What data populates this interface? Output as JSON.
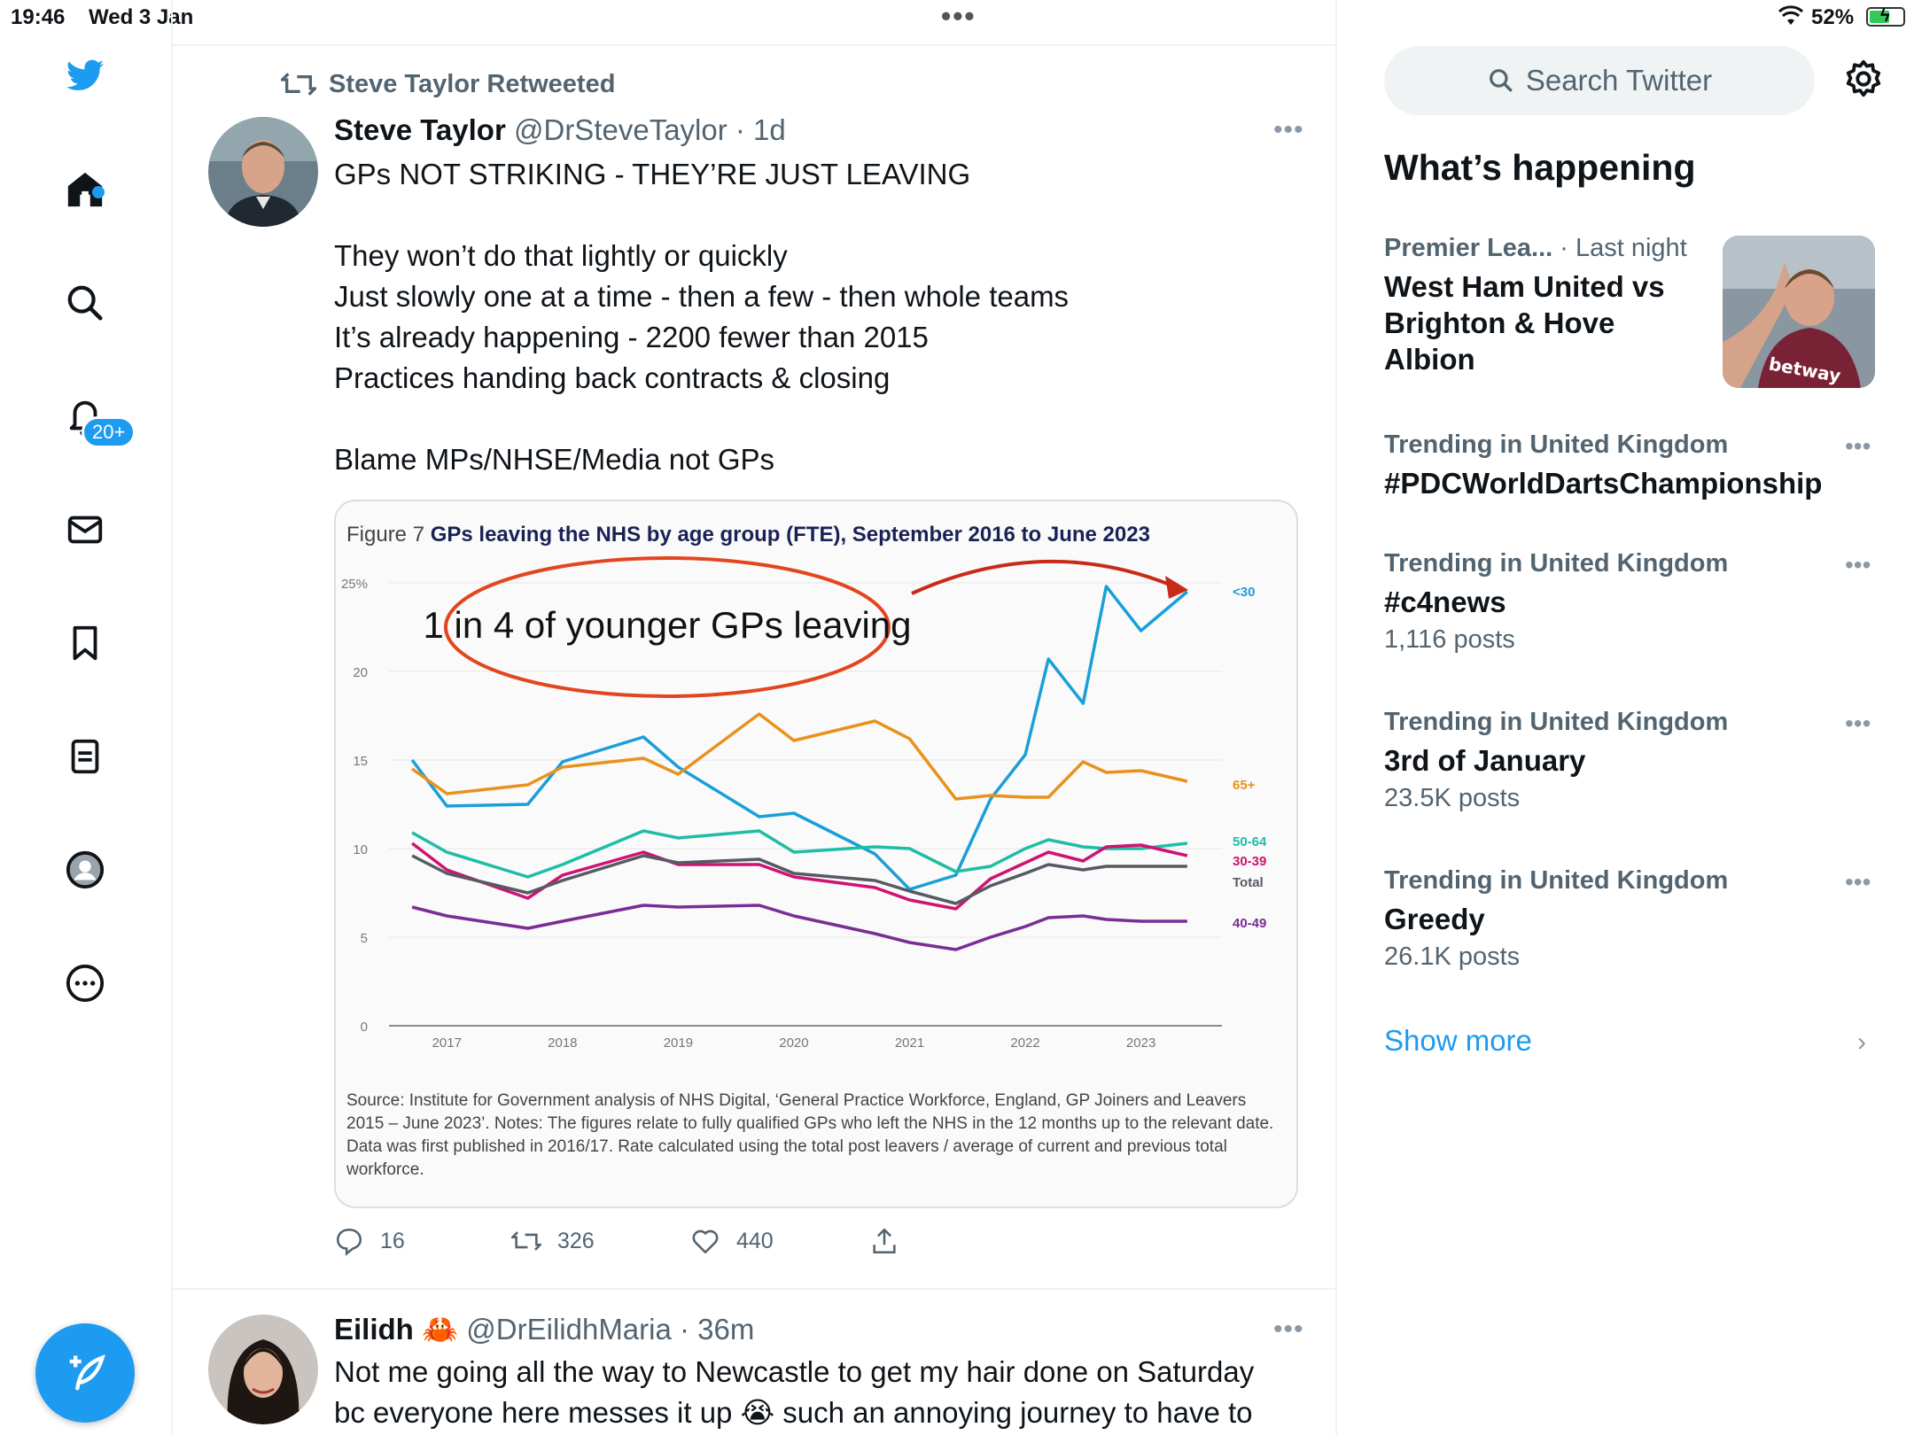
{
  "status_bar": {
    "time": "19:46",
    "date": "Wed 3 Jan",
    "battery": "52%"
  },
  "nav": {
    "notifications_badge": "20+"
  },
  "tweet1": {
    "retweeted_by": "Steve Taylor Retweeted",
    "name": "Steve Taylor",
    "meta": "@DrSteveTaylor · 1d",
    "text": "GPs NOT STRIKING  - THEY’RE JUST LEAVING\n\nThey won’t do that lightly or quickly\nJust slowly one at a time - then a few - then whole teams\nIt’s already happening - 2200 fewer than 2015\nPractices handing back contracts & closing\n\nBlame MPs/NHSE/Media not GPs",
    "figure_label": "Figure 7",
    "figure_title": "GPs leaving the NHS by age group (FTE), September 2016 to June 2023",
    "annotation": "1 in 4 of younger GPs leaving",
    "source": "Source: Institute for Government analysis of NHS Digital, ‘General Practice Workforce, England, GP Joiners and Leavers 2015 – June 2023’. Notes: The figures relate to fully qualified GPs who left the NHS in the 12 months up to the relevant date. Data was first published in 2016/17. Rate calculated using the total post leavers / average of current and previous total workforce.",
    "replies": "16",
    "retweets": "326",
    "likes": "440"
  },
  "tweet2": {
    "name": "Eilidh",
    "emoji": "🦀",
    "meta": "@DrEilidhMaria · 36m",
    "text": "Not me going all the way to Newcastle to get my hair done on Saturday\nbc everyone here messes it up 😭 such an annoying journey to have to"
  },
  "right": {
    "search_placeholder": "Search Twitter",
    "heading": "What’s happening",
    "trends": [
      {
        "context": "Premier Lea...",
        "context_time": " · Last night",
        "title": "West Ham United vs\nBrighton & Hove\nAlbion",
        "count": ""
      },
      {
        "context": "Trending in United Kingdom",
        "title": "#PDCWorldDartsChampionship",
        "count": ""
      },
      {
        "context": "Trending in United Kingdom",
        "title": "#c4news",
        "count": "1,116 posts"
      },
      {
        "context": "Trending in United Kingdom",
        "title": "3rd of January",
        "count": "23.5K posts"
      },
      {
        "context": "Trending in United Kingdom",
        "title": "Greedy",
        "count": "26.1K posts"
      }
    ],
    "show_more": "Show more",
    "news_image_text": "betway"
  },
  "chart_data": {
    "type": "line",
    "title": "GPs leaving the NHS by age group (FTE), September 2016 to June 2023",
    "x": [
      2016.7,
      2017.0,
      2017.7,
      2018.0,
      2018.7,
      2019.0,
      2019.7,
      2020.0,
      2020.7,
      2021.0,
      2021.4,
      2021.7,
      2022.0,
      2022.2,
      2022.5,
      2022.7,
      2023.0,
      2023.4
    ],
    "xticks": [
      "2017",
      "2018",
      "2019",
      "2020",
      "2021",
      "2022",
      "2023"
    ],
    "yticks": [
      "0",
      "5",
      "10",
      "15",
      "20",
      "25%"
    ],
    "ylim": [
      0,
      25
    ],
    "series": [
      {
        "name": "<30",
        "color": "#1a9fd8",
        "values": [
          15.0,
          12.4,
          12.5,
          14.9,
          16.3,
          14.6,
          11.8,
          12.0,
          9.7,
          7.7,
          8.5,
          12.8,
          15.3,
          20.7,
          18.2,
          24.8,
          22.3,
          24.5
        ]
      },
      {
        "name": "65+",
        "color": "#e8921c",
        "values": [
          14.5,
          13.1,
          13.6,
          14.6,
          15.1,
          14.2,
          17.6,
          16.1,
          17.2,
          16.2,
          12.8,
          13.0,
          12.9,
          12.9,
          14.9,
          14.3,
          14.4,
          13.8
        ]
      },
      {
        "name": "50-64",
        "color": "#1fbda6",
        "values": [
          10.9,
          9.8,
          8.4,
          9.1,
          11.0,
          10.6,
          11.0,
          9.8,
          10.1,
          10.0,
          8.7,
          9.0,
          10.0,
          10.5,
          10.1,
          10.0,
          10.0,
          10.3
        ]
      },
      {
        "name": "30-39",
        "color": "#cf1372",
        "values": [
          10.3,
          8.8,
          7.2,
          8.5,
          9.8,
          9.1,
          9.1,
          8.4,
          7.8,
          7.1,
          6.6,
          8.3,
          9.2,
          9.8,
          9.3,
          10.1,
          10.2,
          9.6
        ]
      },
      {
        "name": "Total",
        "color": "#555b63",
        "values": [
          9.6,
          8.6,
          7.5,
          8.2,
          9.6,
          9.2,
          9.4,
          8.6,
          8.2,
          7.6,
          6.9,
          7.9,
          8.6,
          9.1,
          8.8,
          9.0,
          9.0,
          9.0
        ]
      },
      {
        "name": "40-49",
        "color": "#7a2d95",
        "values": [
          6.7,
          6.2,
          5.5,
          5.9,
          6.8,
          6.7,
          6.8,
          6.2,
          5.2,
          4.7,
          4.3,
          5.0,
          5.6,
          6.1,
          6.2,
          6.0,
          5.9,
          5.9
        ]
      }
    ]
  }
}
